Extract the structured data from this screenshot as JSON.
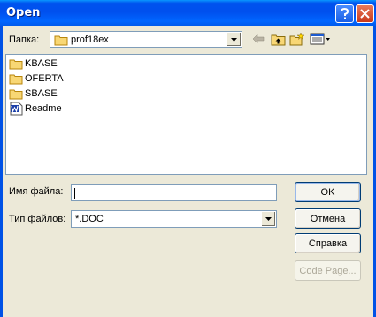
{
  "window": {
    "title": "Open"
  },
  "lookin": {
    "label": "Папка:",
    "value": "prof18ex"
  },
  "files": [
    {
      "name": "KBASE",
      "icon": "folder-icon"
    },
    {
      "name": "OFERTA",
      "icon": "folder-icon"
    },
    {
      "name": "SBASE",
      "icon": "folder-icon"
    },
    {
      "name": "Readme",
      "icon": "word-document-icon"
    }
  ],
  "filename": {
    "label": "Имя файла:",
    "value": ""
  },
  "filetype": {
    "label": "Тип файлов:",
    "value": "*.DOC"
  },
  "buttons": {
    "ok": "OK",
    "cancel": "Отмена",
    "help": "Справка",
    "codepage": "Code Page..."
  },
  "colors": {
    "titlebar": "#0054e3",
    "dialog_bg": "#ece9d8",
    "border": "#7f9db9"
  }
}
